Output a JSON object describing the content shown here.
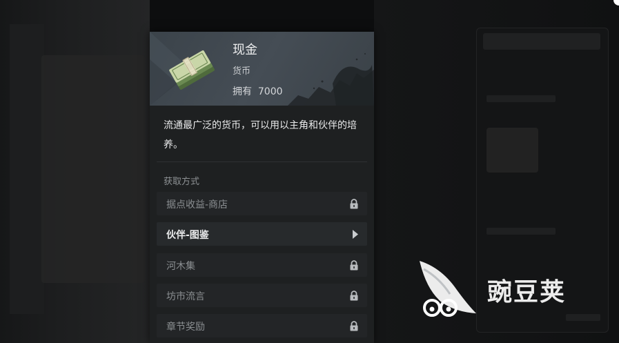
{
  "item": {
    "name": "现金",
    "type": "货币",
    "owned_text": "拥有  7000",
    "description": "流通最广泛的货币，可以用以主角和伙伴的培养。"
  },
  "acquire": {
    "label": "获取方式",
    "sources": [
      {
        "label": "据点收益-商店",
        "state": "locked"
      },
      {
        "label": "伙伴-图鉴",
        "state": "available"
      },
      {
        "label": "河木集",
        "state": "locked"
      },
      {
        "label": "坊市流言",
        "state": "locked"
      },
      {
        "label": "章节奖励",
        "state": "locked"
      }
    ]
  },
  "watermark": {
    "text": "豌豆荚"
  },
  "icons": {
    "item": "cash-stack-icon",
    "lock": "lock-icon",
    "arrow": "chevron-right-icon",
    "watermark": "wandoujia-logo-icon"
  },
  "colors": {
    "panel_bg": "#1e2021",
    "header_bg": "#424a51",
    "text_primary": "#eaebec",
    "text_muted": "#8b8f92"
  }
}
